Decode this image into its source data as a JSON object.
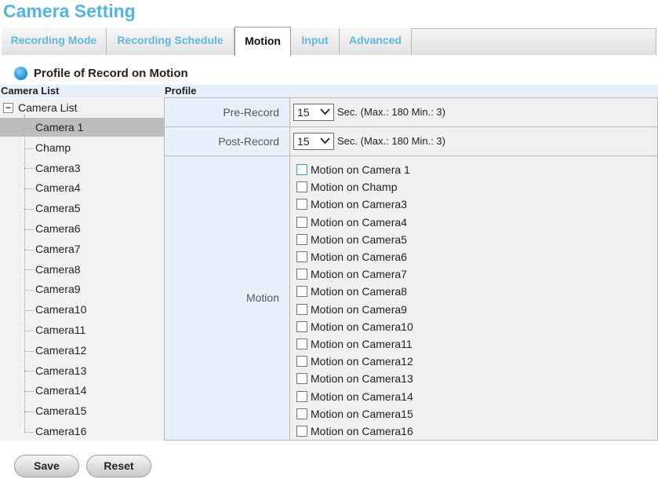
{
  "page": {
    "title": "Camera Setting"
  },
  "tabs": [
    {
      "label": "Recording Mode",
      "active": false
    },
    {
      "label": "Recording Schedule",
      "active": false
    },
    {
      "label": "Motion",
      "active": true
    },
    {
      "label": "Input",
      "active": false
    },
    {
      "label": "Advanced",
      "active": false
    }
  ],
  "section": {
    "title": "Profile of Record on Motion"
  },
  "headers": {
    "camera_list": "Camera List",
    "profile": "Profile"
  },
  "tree": {
    "root_label": "Camera List",
    "toggle_symbol": "−",
    "selected_index": 0,
    "items": [
      "Camera 1",
      "Champ",
      "Camera3",
      "Camera4",
      "Camera5",
      "Camera6",
      "Camera7",
      "Camera8",
      "Camera9",
      "Camera10",
      "Camera11",
      "Camera12",
      "Camera13",
      "Camera14",
      "Camera15",
      "Camera16"
    ]
  },
  "profile": {
    "pre_record": {
      "label": "Pre-Record",
      "value": "15",
      "note": "Sec. (Max.: 180 Min.: 3)"
    },
    "post_record": {
      "label": "Post-Record",
      "value": "15",
      "note": "Sec. (Max.: 180 Min.: 3)"
    },
    "motion": {
      "label": "Motion",
      "options": [
        {
          "label": "Motion on Camera 1",
          "checked": false
        },
        {
          "label": "Motion on Champ",
          "checked": false
        },
        {
          "label": "Motion on Camera3",
          "checked": false
        },
        {
          "label": "Motion on Camera4",
          "checked": false
        },
        {
          "label": "Motion on Camera5",
          "checked": false
        },
        {
          "label": "Motion on Camera6",
          "checked": false
        },
        {
          "label": "Motion on Camera7",
          "checked": false
        },
        {
          "label": "Motion on Camera8",
          "checked": false
        },
        {
          "label": "Motion on Camera9",
          "checked": false
        },
        {
          "label": "Motion on Camera10",
          "checked": false
        },
        {
          "label": "Motion on Camera11",
          "checked": false
        },
        {
          "label": "Motion on Camera12",
          "checked": false
        },
        {
          "label": "Motion on Camera13",
          "checked": false
        },
        {
          "label": "Motion on Camera14",
          "checked": false
        },
        {
          "label": "Motion on Camera15",
          "checked": false
        },
        {
          "label": "Motion on Camera16",
          "checked": false
        }
      ]
    }
  },
  "buttons": {
    "save": "Save",
    "reset": "Reset"
  },
  "colors": {
    "accent": "#4fb6e4",
    "label_bg": "#e8f1fb",
    "selected_row": "#bdbdbd"
  }
}
